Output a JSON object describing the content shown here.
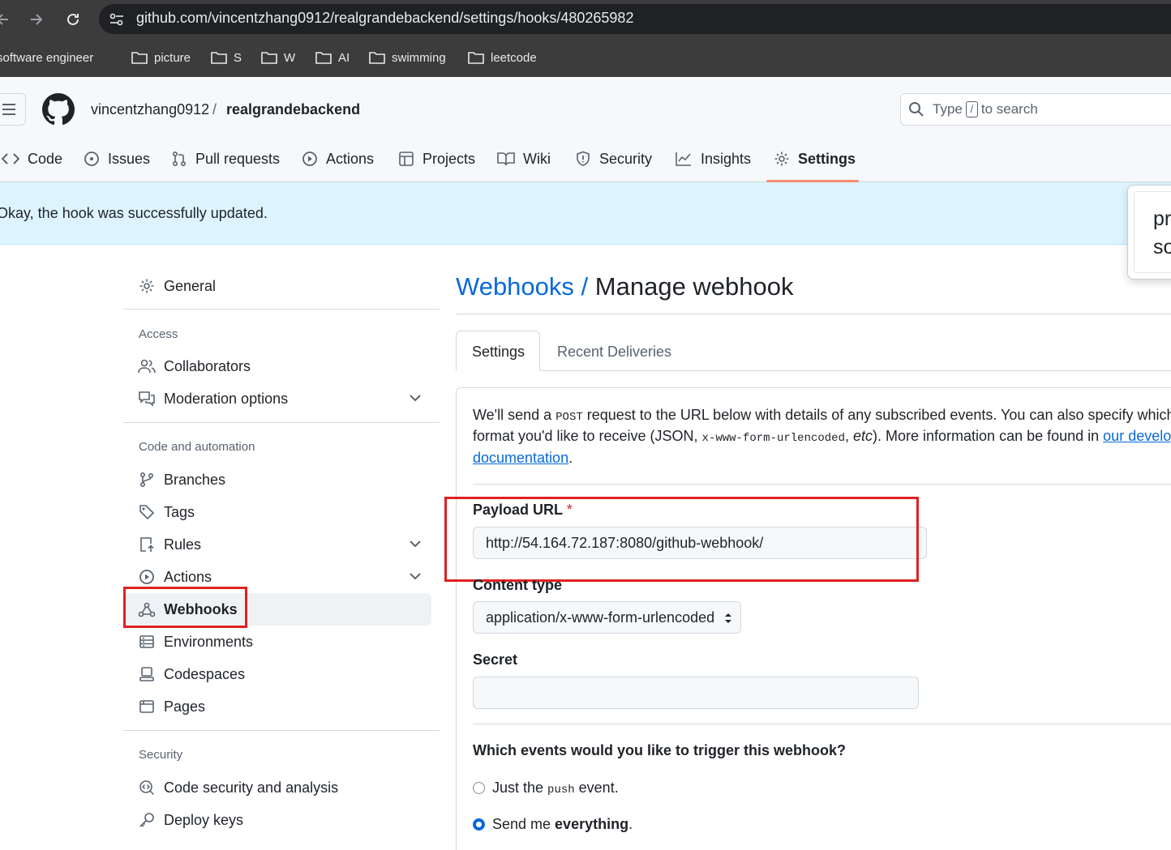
{
  "browser": {
    "url": "github.com/vincentzhang0912/realgrandebackend/settings/hooks/480265982",
    "bookmarks": [
      "software engineer",
      "picture",
      "S",
      "W",
      "AI",
      "swimming",
      "leetcode"
    ]
  },
  "header": {
    "owner": "vincentzhang0912",
    "separator": "/",
    "repo": "realgrandebackend",
    "search_prefix": "Type",
    "search_key": "/",
    "search_suffix": "to search"
  },
  "repo_tabs": [
    "Code",
    "Issues",
    "Pull requests",
    "Actions",
    "Projects",
    "Wiki",
    "Security",
    "Insights",
    "Settings"
  ],
  "flash": {
    "message": "Okay, the hook was successfully updated.",
    "popup_line1": "pr",
    "popup_line2": "so"
  },
  "sidebar": {
    "general": "General",
    "access_heading": "Access",
    "collaborators": "Collaborators",
    "moderation": "Moderation options",
    "code_heading": "Code and automation",
    "branches": "Branches",
    "tags": "Tags",
    "rules": "Rules",
    "actions": "Actions",
    "webhooks": "Webhooks",
    "environments": "Environments",
    "codespaces": "Codespaces",
    "pages": "Pages",
    "security_heading": "Security",
    "code_security": "Code security and analysis",
    "deploy_keys": "Deploy keys"
  },
  "main": {
    "title_link": "Webhooks",
    "title_sep": "/",
    "title": "Manage webhook",
    "tabs": [
      "Settings",
      "Recent Deliveries"
    ],
    "intro": {
      "p1": "We'll send a ",
      "post": "POST",
      "p2": " request to the URL below with details of any subscribed events. You can also specify which data",
      "p3": "format you'd like to receive (JSON, ",
      "form": "x-www-form-urlencoded",
      "p4": ", ",
      "etc": "etc",
      "p5": "). More information can be found in ",
      "link1": "our developer",
      "link2": "documentation",
      "p6": "."
    },
    "payload_label": "Payload URL",
    "required_mark": "*",
    "payload_value": "http://54.164.72.187:8080/github-webhook/",
    "content_type_label": "Content type",
    "content_type_value": "application/x-www-form-urlencoded",
    "secret_label": "Secret",
    "secret_value": "",
    "events_question": "Which events would you like to trigger this webhook?",
    "radio_push_pre": "Just the ",
    "radio_push_code": "push",
    "radio_push_post": " event.",
    "radio_all_pre": "Send me ",
    "radio_all_bold": "everything",
    "radio_all_post": "."
  },
  "colors": {
    "accent": "#0969da",
    "flash_bg": "#ddf4ff",
    "annotation_red": "#e02020",
    "tab_underline": "#fd8c73"
  }
}
